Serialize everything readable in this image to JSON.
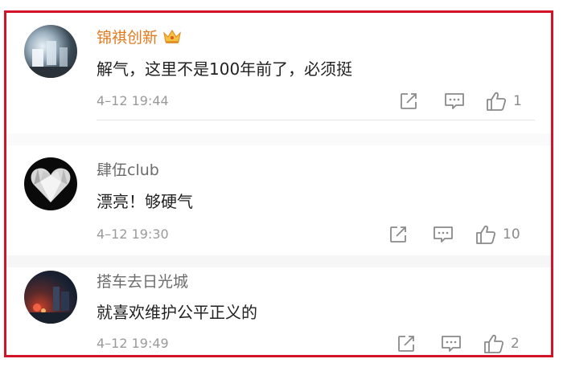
{
  "comments": [
    {
      "username": "锦祺创新",
      "vip": true,
      "badge_icon": "crown-icon",
      "text": "解气，这里不是100年前了，必须挺",
      "timestamp": "4–12 19:44",
      "likes": "1"
    },
    {
      "username": "肆伍club",
      "vip": false,
      "text": "漂亮！够硬气",
      "timestamp": "4–12 19:30",
      "likes": "10"
    },
    {
      "username": "搭车去日光城",
      "vip": false,
      "text": "就喜欢维护公平正义的",
      "timestamp": "4–12 19:49",
      "likes": "2"
    }
  ],
  "icons": {
    "share": "share-icon",
    "reply": "comment-icon",
    "like": "thumbs-up-icon"
  },
  "colors": {
    "highlight_border": "#d2142a",
    "vip_name": "#e07a1f",
    "username": "#6c6c6c",
    "meta_text": "#9a9a9a"
  }
}
